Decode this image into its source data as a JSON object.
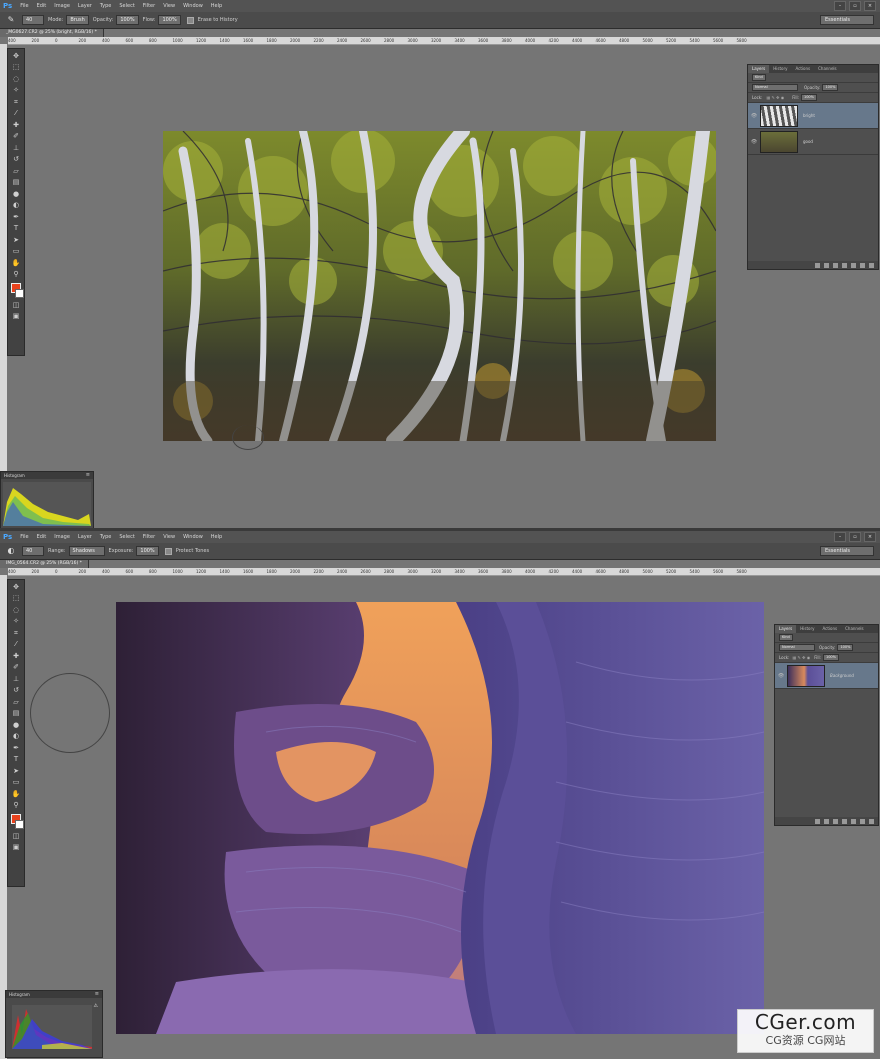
{
  "app_name": "Ps",
  "menu": [
    "File",
    "Edit",
    "Image",
    "Layer",
    "Type",
    "Select",
    "Filter",
    "View",
    "Window",
    "Help"
  ],
  "workspace": "Essentials",
  "window1": {
    "tool_icon": "eraser-icon",
    "options": {
      "mode_label": "Mode:",
      "mode_value": "Brush",
      "opacity_label": "Opacity:",
      "opacity_value": "100%",
      "flow_label": "Flow:",
      "flow_value": "100%",
      "erase_history_label": "Erase to History"
    },
    "doc_tab": "_MG0627.CR2 @ 25% (bright, RGB/16) *",
    "layers_panel": {
      "tabs": [
        "Layers",
        "History",
        "Actions",
        "Channels"
      ],
      "kind": "Kind",
      "blend_mode": "Normal",
      "opacity_label": "Opacity:",
      "opacity_value": "100%",
      "lock_label": "Lock:",
      "fill_label": "Fill:",
      "fill_value": "100%",
      "layers": [
        {
          "name": "bright",
          "selected": true
        },
        {
          "name": "good",
          "selected": false
        }
      ]
    },
    "histogram_title": "Histogram",
    "histogram_warning": "⚠"
  },
  "window2": {
    "tool_icon": "dodge-icon",
    "options": {
      "range_label": "Range:",
      "range_value": "Shadows",
      "exposure_label": "Exposure:",
      "exposure_value": "100%",
      "protect_tones_label": "Protect Tones"
    },
    "doc_tab": "IMG_0564.CR2 @ 25% (RGB/16) *",
    "layers_panel": {
      "tabs": [
        "Layers",
        "History",
        "Actions",
        "Channels"
      ],
      "kind": "Kind",
      "blend_mode": "Normal",
      "opacity_label": "Opacity:",
      "opacity_value": "100%",
      "lock_label": "Lock:",
      "fill_label": "Fill:",
      "fill_value": "100%",
      "layers": [
        {
          "name": "Background",
          "selected": true
        }
      ]
    },
    "histogram_title": "Histogram",
    "histogram_warning": "⚠"
  },
  "ruler_labels": [
    "400",
    "200",
    "0",
    "200",
    "400",
    "600",
    "800",
    "1000",
    "1200",
    "1400",
    "1600",
    "1800",
    "2000",
    "2200",
    "2400",
    "2600",
    "2800",
    "3000",
    "3200",
    "3400",
    "3600",
    "3800",
    "4000",
    "4200",
    "4400",
    "4600",
    "4800",
    "5000",
    "5200",
    "5400",
    "5600",
    "5800"
  ],
  "watermark": {
    "line1": "CGer.com",
    "line2": "CG资源 CG网站"
  },
  "colors": {
    "foreground": "#e8421d",
    "background": "#ffffff",
    "selection": "#67788b",
    "ps_blue": "#4aa8ff"
  }
}
